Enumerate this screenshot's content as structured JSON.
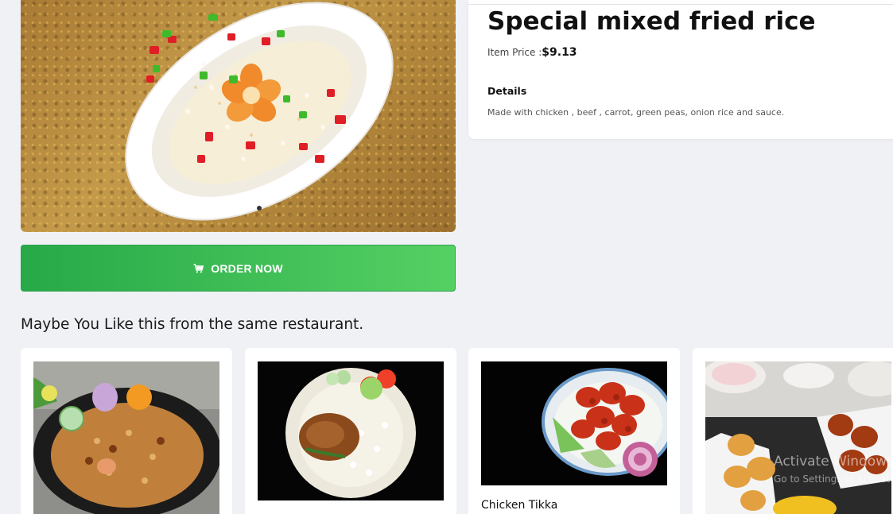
{
  "product": {
    "title": "Special mixed fried rice",
    "price_label": "Item Price :",
    "price": "$9.13",
    "details_heading": "Details",
    "details_text": "Made with chicken , beef , carrot, green peas, onion rice and sauce."
  },
  "order_button": {
    "label": "ORDER NOW",
    "icon": "cart-icon"
  },
  "carousel": {
    "active_index": 1,
    "dot_count": 1
  },
  "recommendations": {
    "heading": "Maybe You Like this from the same restaurant.",
    "items": [
      {
        "name": "",
        "image": "biryani-photo"
      },
      {
        "name": "",
        "image": "chicken-rice-plate-photo"
      },
      {
        "name": "Chicken Tikka",
        "image": "chicken-tikka-photo"
      },
      {
        "name": "",
        "image": "fried-chicken-photo"
      }
    ]
  },
  "os_watermark": {
    "line1": "Activate Windows",
    "line2": "Go to Settings to activate Windows."
  },
  "colors": {
    "accent_green_start": "#27a948",
    "accent_green_end": "#55d063",
    "background": "#f0f1f5"
  }
}
